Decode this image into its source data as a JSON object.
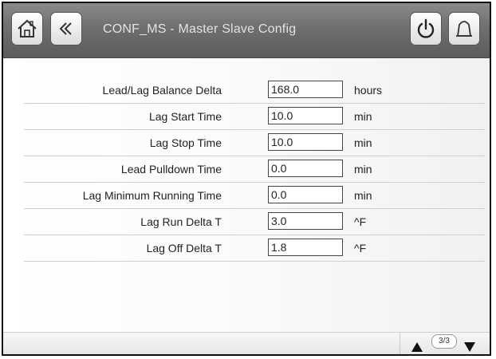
{
  "header": {
    "title": "CONF_MS  - Master Slave Config",
    "buttons": {
      "home": "home-icon",
      "back": "back-icon",
      "power": "power-icon",
      "alarm": "bell-icon"
    }
  },
  "rows": [
    {
      "label": "Lead/Lag Balance Delta",
      "value": "168.0",
      "unit": "hours"
    },
    {
      "label": "Lag Start Time",
      "value": "10.0",
      "unit": "min"
    },
    {
      "label": "Lag Stop Time",
      "value": "10.0",
      "unit": "min"
    },
    {
      "label": "Lead Pulldown Time",
      "value": "0.0",
      "unit": "min"
    },
    {
      "label": "Lag Minimum Running Time",
      "value": "0.0",
      "unit": "min"
    },
    {
      "label": "Lag Run Delta T",
      "value": "3.0",
      "unit": "^F"
    },
    {
      "label": "Lag Off Delta T",
      "value": "1.8",
      "unit": "^F"
    }
  ],
  "footer": {
    "page_indicator": "3/3"
  }
}
